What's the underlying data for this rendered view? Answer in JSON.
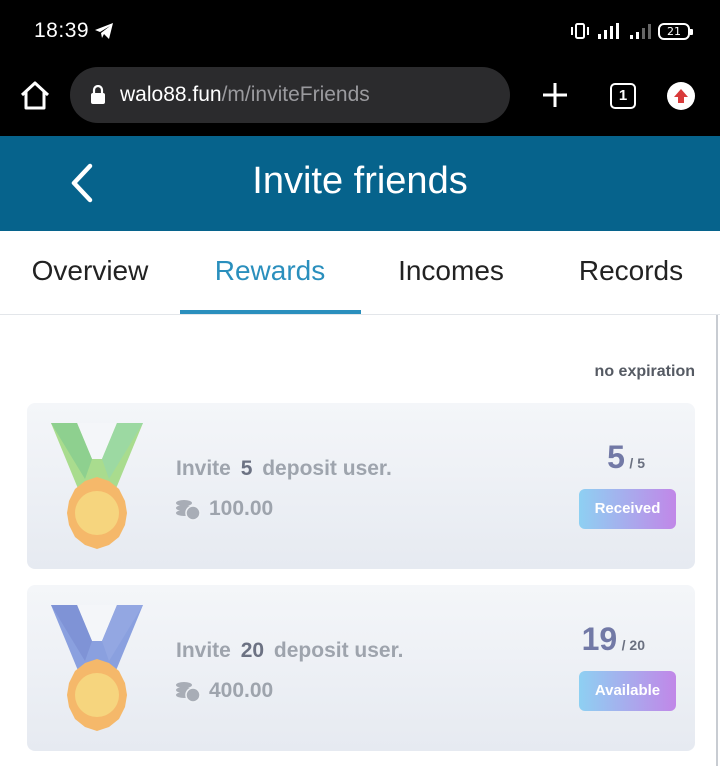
{
  "status_bar": {
    "time": "18:39",
    "battery": "21"
  },
  "browser": {
    "url_host": "walo88.fun",
    "url_path": "/m/inviteFriends",
    "tab_count": "1"
  },
  "header": {
    "title": "Invite friends"
  },
  "tabs": [
    {
      "label": "Overview",
      "active": false
    },
    {
      "label": "Rewards",
      "active": true
    },
    {
      "label": "Incomes",
      "active": false
    },
    {
      "label": "Records",
      "active": false
    }
  ],
  "expiry_text": "no expiration",
  "rewards": [
    {
      "prefix": "Invite",
      "count": "5",
      "suffix": "deposit user.",
      "amount": "100.00",
      "progress_current": "5",
      "progress_total": "/ 5",
      "status": "Received",
      "medal_color": "#8ed08f"
    },
    {
      "prefix": "Invite",
      "count": "20",
      "suffix": "deposit user.",
      "amount": "400.00",
      "progress_current": "19",
      "progress_total": "/ 20",
      "status": "Available",
      "medal_color": "#7f93d6"
    }
  ]
}
